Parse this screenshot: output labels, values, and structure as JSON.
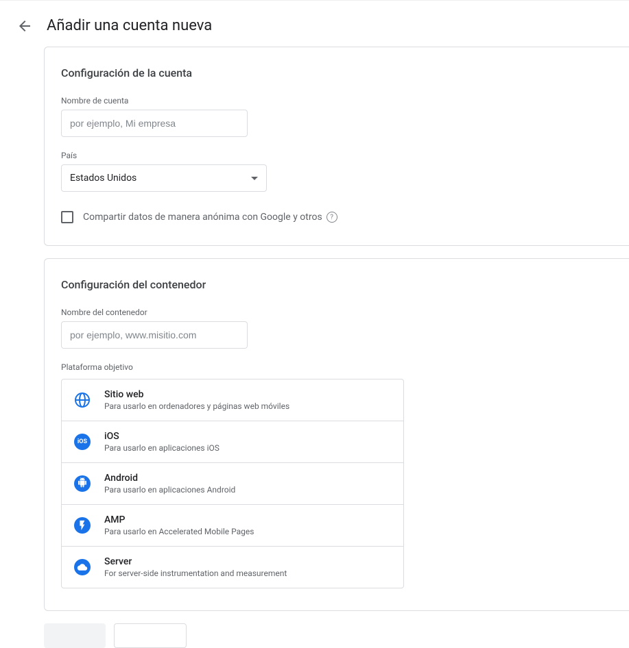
{
  "page": {
    "title": "Añadir una cuenta nueva"
  },
  "account": {
    "section_title": "Configuración de la cuenta",
    "name_label": "Nombre de cuenta",
    "name_placeholder": "por ejemplo, Mi empresa",
    "country_label": "País",
    "country_value": "Estados Unidos",
    "share_checkbox_label": "Compartir datos de manera anónima con Google y otros"
  },
  "container": {
    "section_title": "Configuración del contenedor",
    "name_label": "Nombre del contenedor",
    "name_placeholder": "por ejemplo, www.misitio.com",
    "platform_label": "Plataforma objetivo",
    "platforms": [
      {
        "name": "Sitio web",
        "desc": "Para usarlo en ordenadores y páginas web móviles"
      },
      {
        "name": "iOS",
        "desc": "Para usarlo en aplicaciones iOS"
      },
      {
        "name": "Android",
        "desc": "Para usarlo en aplicaciones Android"
      },
      {
        "name": "AMP",
        "desc": "Para usarlo en Accelerated Mobile Pages"
      },
      {
        "name": "Server",
        "desc": "For server-side instrumentation and measurement"
      }
    ]
  }
}
